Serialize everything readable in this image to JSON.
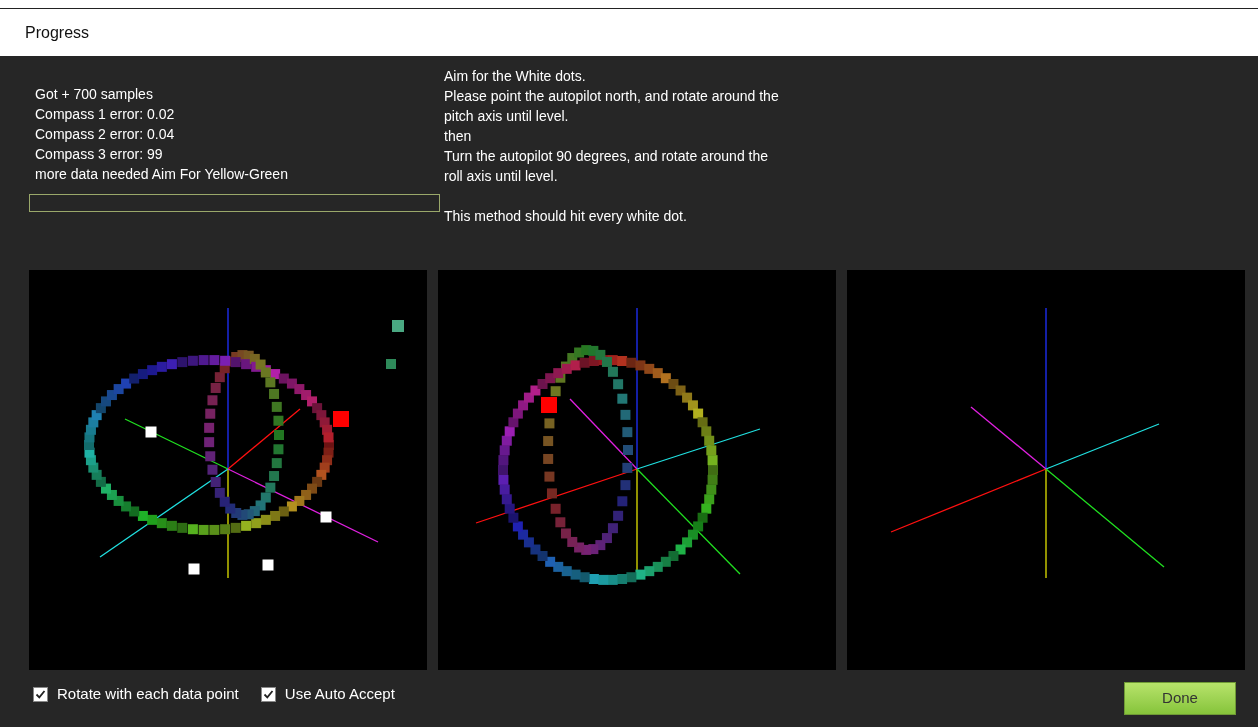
{
  "window": {
    "title": "Progress"
  },
  "status_lines": [
    "Got + 700 samples",
    "Compass 1 error: 0.02",
    "Compass 2 error: 0.04",
    "Compass 3 error: 99",
    "more data needed Aim For Yellow-Green"
  ],
  "progress": {
    "level": 0
  },
  "instructions": [
    "Aim for the White dots.",
    "Please point the autopilot north, and rotate around the pitch axis until level.",
    "then",
    "Turn the autopilot 90 degrees, and rotate around the roll axis until level."
  ],
  "note": "This method should hit every white dot.",
  "checkboxes": [
    {
      "label": "Rotate with each data point",
      "checked": true
    },
    {
      "label": "Use Auto Accept",
      "checked": true
    }
  ],
  "done_button": "Done"
}
